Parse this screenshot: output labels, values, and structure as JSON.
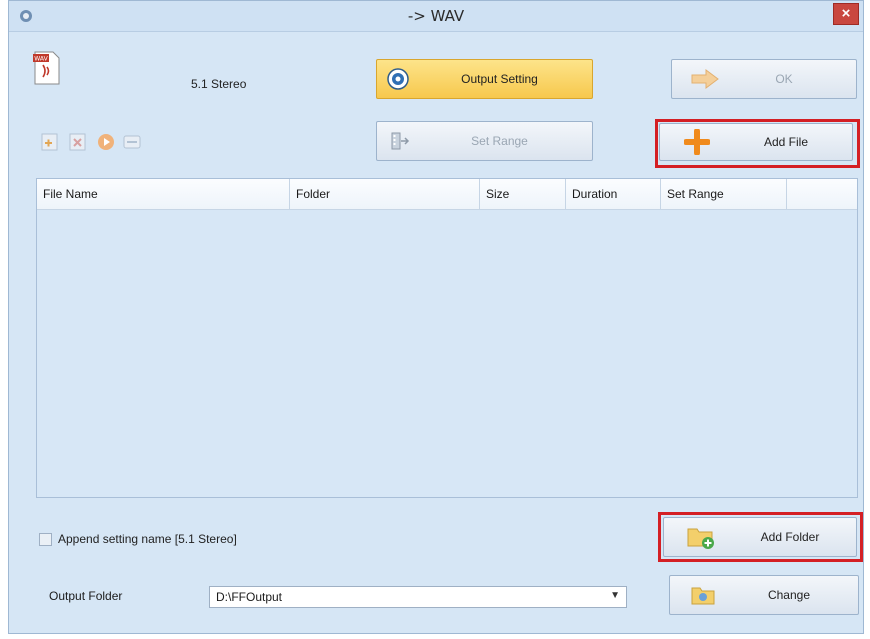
{
  "window": {
    "title": "-> WAV",
    "close_glyph": "×"
  },
  "preset": {
    "name": "5.1 Stereo",
    "icon": "wav-file-icon"
  },
  "toolbar": {
    "output_setting_label": "Output Setting",
    "ok_label": "OK",
    "set_range_label": "Set Range",
    "add_file_label": "Add File"
  },
  "file_list": {
    "columns": [
      "File Name",
      "Folder",
      "Size",
      "Duration",
      "Set Range"
    ],
    "rows": []
  },
  "footer": {
    "append_label": "Append setting name [5.1 Stereo]",
    "append_checked": false,
    "add_folder_label": "Add Folder",
    "output_folder_label": "Output Folder",
    "output_folder_value": "D:\\FFOutput",
    "change_label": "Change"
  },
  "colors": {
    "highlight": "#d41f24",
    "accent": "#f7c84d",
    "window_bg": "#d6e6f5"
  }
}
